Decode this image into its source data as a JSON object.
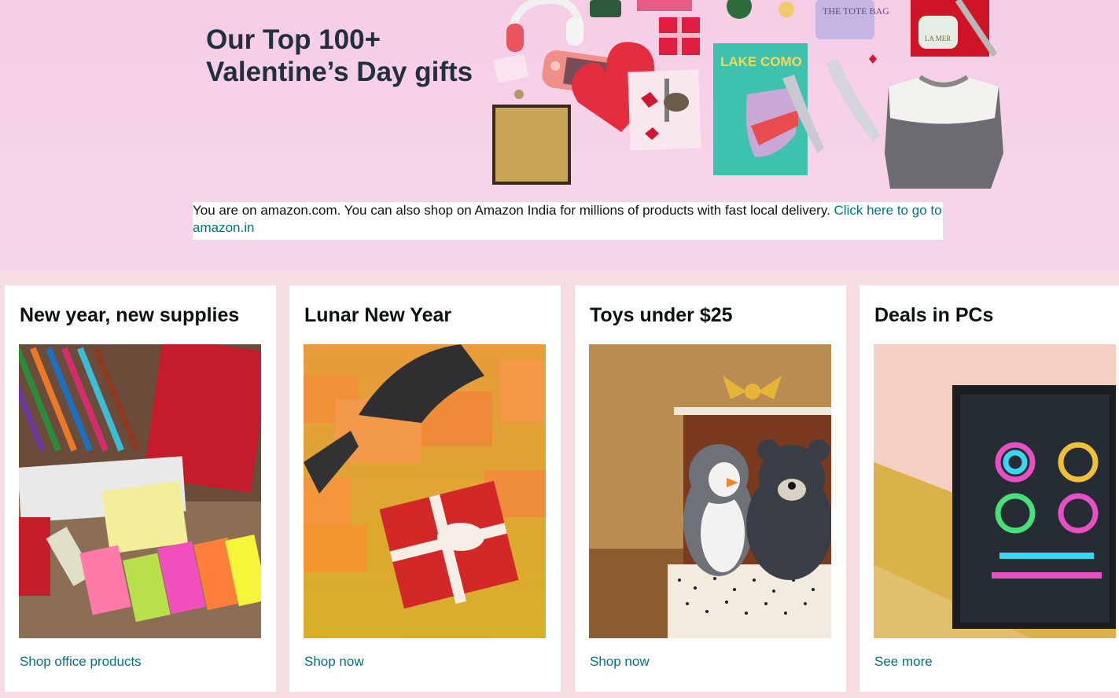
{
  "hero": {
    "title_line1": "Our Top 100+",
    "title_line2": "Valentine’s Day gifts",
    "product_labels": {
      "tote_bag": "THE TOTE BAG",
      "lamer": "LA MER",
      "book": "LAKE COMO"
    }
  },
  "notice": {
    "text": "You are on amazon.com. You can also shop on Amazon India for millions of products with fast local delivery. ",
    "link": "Click here to go to amazon.in"
  },
  "cards": [
    {
      "title": "New year, new supplies",
      "link": "Shop office products"
    },
    {
      "title": "Lunar New Year",
      "link": "Shop now"
    },
    {
      "title": "Toys under $25",
      "link": "Shop now"
    },
    {
      "title": "Deals in PCs",
      "link": "See more"
    }
  ],
  "colors": {
    "link": "#007185",
    "heading": "#232f3e",
    "page_bg": "#f6dde2",
    "hero_bg": "#f5cde6"
  }
}
